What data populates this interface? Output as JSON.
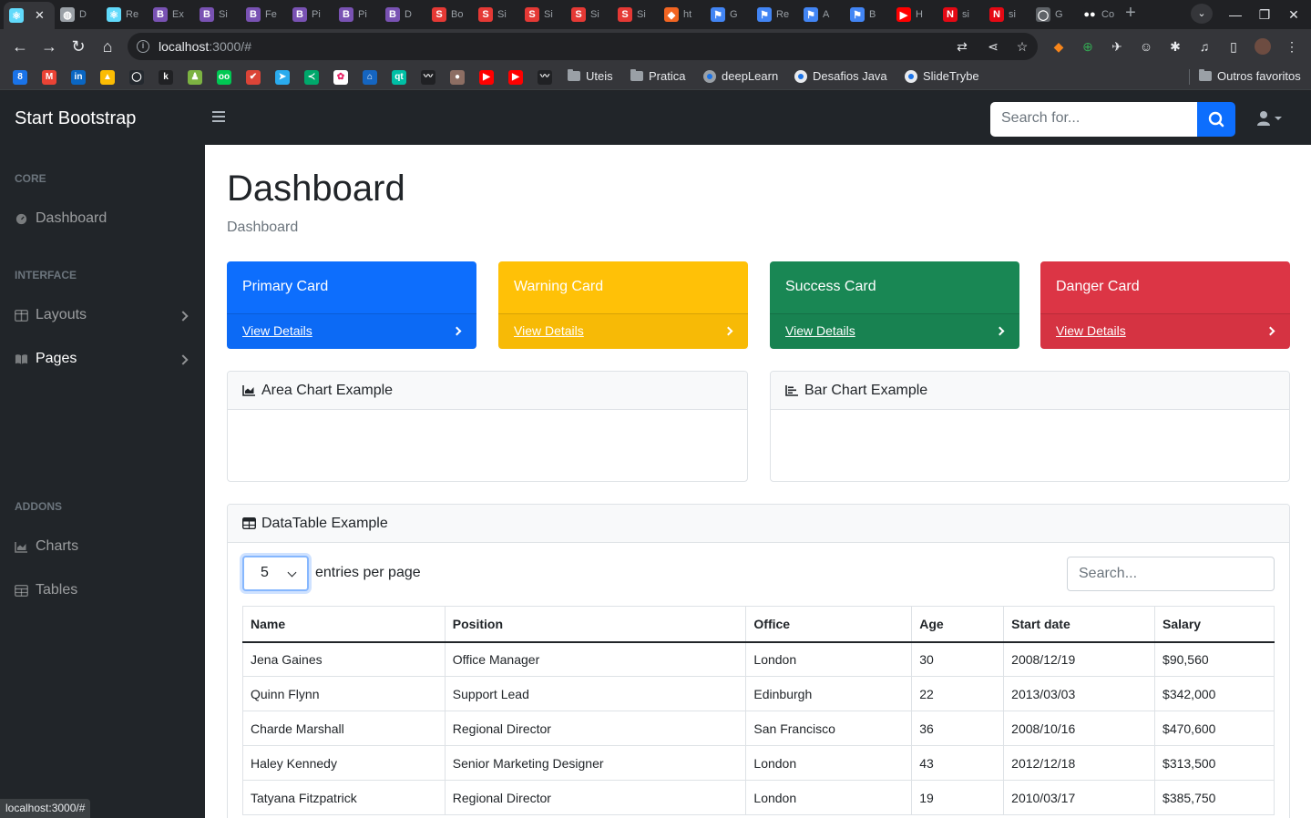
{
  "browser": {
    "tabs": [
      {
        "title": "",
        "favicon_color": "#61dafb",
        "favicon_text": "⚛",
        "active": true
      },
      {
        "title": "D",
        "favicon_color": "#9aa0a6",
        "favicon_text": "◍"
      },
      {
        "title": "Re",
        "favicon_color": "#61dafb",
        "favicon_text": "⚛"
      },
      {
        "title": "Ex",
        "favicon_color": "#7952b3",
        "favicon_text": "B"
      },
      {
        "title": "Si",
        "favicon_color": "#7952b3",
        "favicon_text": "B"
      },
      {
        "title": "Fe",
        "favicon_color": "#7952b3",
        "favicon_text": "B"
      },
      {
        "title": "Pi",
        "favicon_color": "#7952b3",
        "favicon_text": "B"
      },
      {
        "title": "Pi",
        "favicon_color": "#7952b3",
        "favicon_text": "B"
      },
      {
        "title": "D",
        "favicon_color": "#7952b3",
        "favicon_text": "B"
      },
      {
        "title": "Bo",
        "favicon_color": "#e53935",
        "favicon_text": "S"
      },
      {
        "title": "Si",
        "favicon_color": "#e53935",
        "favicon_text": "S"
      },
      {
        "title": "Si",
        "favicon_color": "#e53935",
        "favicon_text": "S"
      },
      {
        "title": "Si",
        "favicon_color": "#e53935",
        "favicon_text": "S"
      },
      {
        "title": "Si",
        "favicon_color": "#e53935",
        "favicon_text": "S"
      },
      {
        "title": "ht",
        "favicon_color": "#f26522",
        "favicon_text": "◆"
      },
      {
        "title": "G",
        "favicon_color": "#4285f4",
        "favicon_text": "⚑"
      },
      {
        "title": "Re",
        "favicon_color": "#4285f4",
        "favicon_text": "⚑"
      },
      {
        "title": "A",
        "favicon_color": "#4285f4",
        "favicon_text": "⚑"
      },
      {
        "title": "B",
        "favicon_color": "#4285f4",
        "favicon_text": "⚑"
      },
      {
        "title": "H",
        "favicon_color": "#ff0000",
        "favicon_text": "▶"
      },
      {
        "title": "si",
        "favicon_color": "#e50914",
        "favicon_text": "N"
      },
      {
        "title": "si",
        "favicon_color": "#e50914",
        "favicon_text": "N"
      },
      {
        "title": "G",
        "favicon_color": "#5f6368",
        "favicon_text": "◯"
      },
      {
        "title": "Co",
        "favicon_color": "#202124",
        "favicon_text": "●●"
      }
    ],
    "url_host": "localhost",
    "url_rest": ":3000/#",
    "bookmarks": [
      {
        "color": "#1a73e8",
        "text": "8"
      },
      {
        "color": "#ea4335",
        "text": "M"
      },
      {
        "color": "#0a66c2",
        "text": "in"
      },
      {
        "color": "#fbbc04",
        "text": "▲"
      },
      {
        "color": "#24292f",
        "text": "◯"
      },
      {
        "color": "#202124",
        "text": "k"
      },
      {
        "color": "#7cb342",
        "text": "♟"
      },
      {
        "color": "#00c853",
        "text": "oo"
      },
      {
        "color": "#db4437",
        "text": "✔"
      },
      {
        "color": "#2aabee",
        "text": "➤"
      },
      {
        "color": "#00a86b",
        "text": "≺"
      },
      {
        "color": "#ffffff",
        "text": "✿"
      },
      {
        "color": "#1565c0",
        "text": "⌂"
      },
      {
        "color": "#00bfa5",
        "text": "qt"
      },
      {
        "color": "#202124",
        "text": "〰"
      },
      {
        "color": "#8d6e63",
        "text": "●"
      },
      {
        "color": "#ff0000",
        "text": "▶"
      },
      {
        "color": "#ff0000",
        "text": "▶"
      },
      {
        "color": "#202124",
        "text": "〰"
      }
    ],
    "folders": [
      {
        "label": "Uteis"
      },
      {
        "label": "Pratica"
      }
    ],
    "named_bookmarks": [
      {
        "label": "deepLearn"
      },
      {
        "label": "Desafios Java"
      },
      {
        "label": "SlideTrybe"
      }
    ],
    "other_favorites": "Outros favoritos",
    "status_url": "localhost:3000/#"
  },
  "app": {
    "brand": "Start Bootstrap",
    "search_placeholder": "Search for...",
    "sidebar": {
      "sections": [
        {
          "heading": "CORE"
        },
        {
          "heading": "INTERFACE"
        },
        {
          "heading": "ADDONS"
        }
      ],
      "items": [
        {
          "label": "Dashboard",
          "icon": "gauge-icon"
        },
        {
          "label": "Layouts",
          "icon": "columns-icon"
        },
        {
          "label": "Pages",
          "icon": "book-open-icon"
        },
        {
          "label": "Charts",
          "icon": "chart-area-icon"
        },
        {
          "label": "Tables",
          "icon": "table-icon"
        }
      ]
    },
    "page_title": "Dashboard",
    "breadcrumb": "Dashboard",
    "stat_cards": [
      {
        "title": "Primary Card",
        "link": "View Details",
        "color": "#0d6efd"
      },
      {
        "title": "Warning Card",
        "link": "View Details",
        "color": "#ffc107"
      },
      {
        "title": "Success Card",
        "link": "View Details",
        "color": "#198754"
      },
      {
        "title": "Danger Card",
        "link": "View Details",
        "color": "#dc3545"
      }
    ],
    "area_chart_title": "Area Chart Example",
    "bar_chart_title": "Bar Chart Example",
    "datatable": {
      "title": "DataTable Example",
      "per_page_value": "5",
      "per_page_label": "entries per page",
      "search_placeholder": "Search...",
      "columns": [
        "Name",
        "Position",
        "Office",
        "Age",
        "Start date",
        "Salary"
      ],
      "rows": [
        [
          "Jena Gaines",
          "Office Manager",
          "London",
          "30",
          "2008/12/19",
          "$90,560"
        ],
        [
          "Quinn Flynn",
          "Support Lead",
          "Edinburgh",
          "22",
          "2013/03/03",
          "$342,000"
        ],
        [
          "Charde Marshall",
          "Regional Director",
          "San Francisco",
          "36",
          "2008/10/16",
          "$470,600"
        ],
        [
          "Haley Kennedy",
          "Senior Marketing Designer",
          "London",
          "43",
          "2012/12/18",
          "$313,500"
        ],
        [
          "Tatyana Fitzpatrick",
          "Regional Director",
          "London",
          "19",
          "2010/03/17",
          "$385,750"
        ]
      ]
    }
  }
}
